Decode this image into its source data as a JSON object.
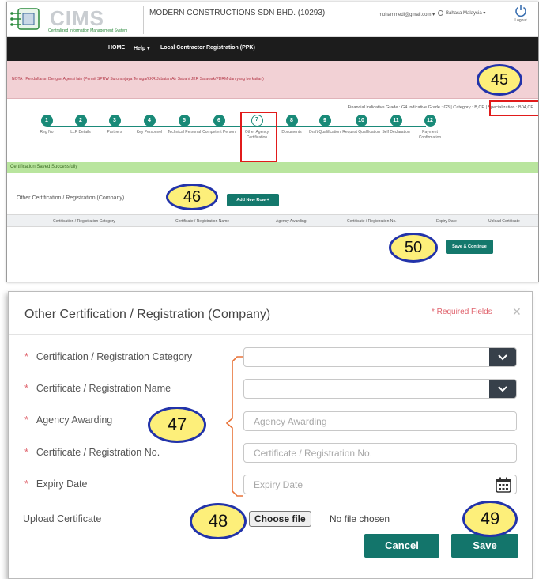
{
  "header": {
    "logo_text": "CIMS",
    "logo_subtitle": "Centralized Information Management System",
    "company": "MODERN CONSTRUCTIONS SDN BHD. (10293)",
    "user_email": "mohammedi@gmail.com ▾",
    "language": "Bahasa Malaysia ▾",
    "logout_label": "Logout"
  },
  "nav": {
    "items": [
      "HOME",
      "Help ▾",
      "Local Contractor Registration (PPK)"
    ]
  },
  "note": {
    "text": "NOTA : Pendaftaran Dengan Agensi lain (Permit SPRW Suruhanjaya Tenaga/KKR/Jabatan Air Sabah/ JKR Sarawak/PDRM dan yang berkaitan)"
  },
  "grade_line": {
    "text": "Financial Indicative Grade : G4   Indicative Grade : G3 | Category : B,CE | Specialization : B04,CE"
  },
  "steps": [
    {
      "num": "1",
      "label": "Reg No"
    },
    {
      "num": "2",
      "label": "LLP Details"
    },
    {
      "num": "3",
      "label": "Partners"
    },
    {
      "num": "4",
      "label": "Key Personnel"
    },
    {
      "num": "5",
      "label": "Technical Personal"
    },
    {
      "num": "6",
      "label": "Competent Person"
    },
    {
      "num": "7",
      "label": "Other Agency Certification"
    },
    {
      "num": "8",
      "label": "Documents"
    },
    {
      "num": "9",
      "label": "Draft Qualification"
    },
    {
      "num": "10",
      "label": "Request Qualification"
    },
    {
      "num": "11",
      "label": "Self Declaration"
    },
    {
      "num": "12",
      "label": "Payment Confirmation"
    }
  ],
  "success_message": "Certification Saved Successfully",
  "section": {
    "title": "Other Certification / Registration (Company)",
    "add_row_label": "Add New Row +"
  },
  "table": {
    "headers": [
      "Certification / Registration Category",
      "Certificate / Registration Name",
      "Agency Awarding",
      "Certificate / Registration No.",
      "Expiry Date",
      "Upload Certificate"
    ]
  },
  "save_continue_label": "Save & Continue",
  "callouts": {
    "c45": "45",
    "c46": "46",
    "c47": "47",
    "c48": "48",
    "c49": "49",
    "c50": "50"
  },
  "modal": {
    "title": "Other Certification / Registration (Company)",
    "required_note": "* Required Fields",
    "close": "✕",
    "fields": {
      "category_label": "Certification / Registration Category",
      "name_label": "Certificate / Registration Name",
      "agency_label": "Agency Awarding",
      "agency_placeholder": "Agency Awarding",
      "cert_no_label": "Certificate / Registration No.",
      "cert_no_placeholder": "Certificate / Registration No.",
      "expiry_label": "Expiry Date",
      "expiry_placeholder": "Expiry Date",
      "upload_label": "Upload Certificate",
      "choose_file": "Choose file",
      "no_file": "No file chosen"
    },
    "required_marker": "*",
    "cancel_label": "Cancel",
    "save_label": "Save"
  },
  "colors": {
    "primary_teal": "#13756b",
    "highlight_red": "#e11b1b",
    "callout_fill": "#fdef7a",
    "callout_border": "#2233aa",
    "success_green": "#b9e59e",
    "note_pink": "#f2d1d5",
    "navbar_black": "#1c1c1c"
  },
  "icons": {
    "logout": "power-icon",
    "language": "globe-icon",
    "dropdown": "chevron-down-icon",
    "calendar": "calendar-icon",
    "close": "close-icon"
  }
}
